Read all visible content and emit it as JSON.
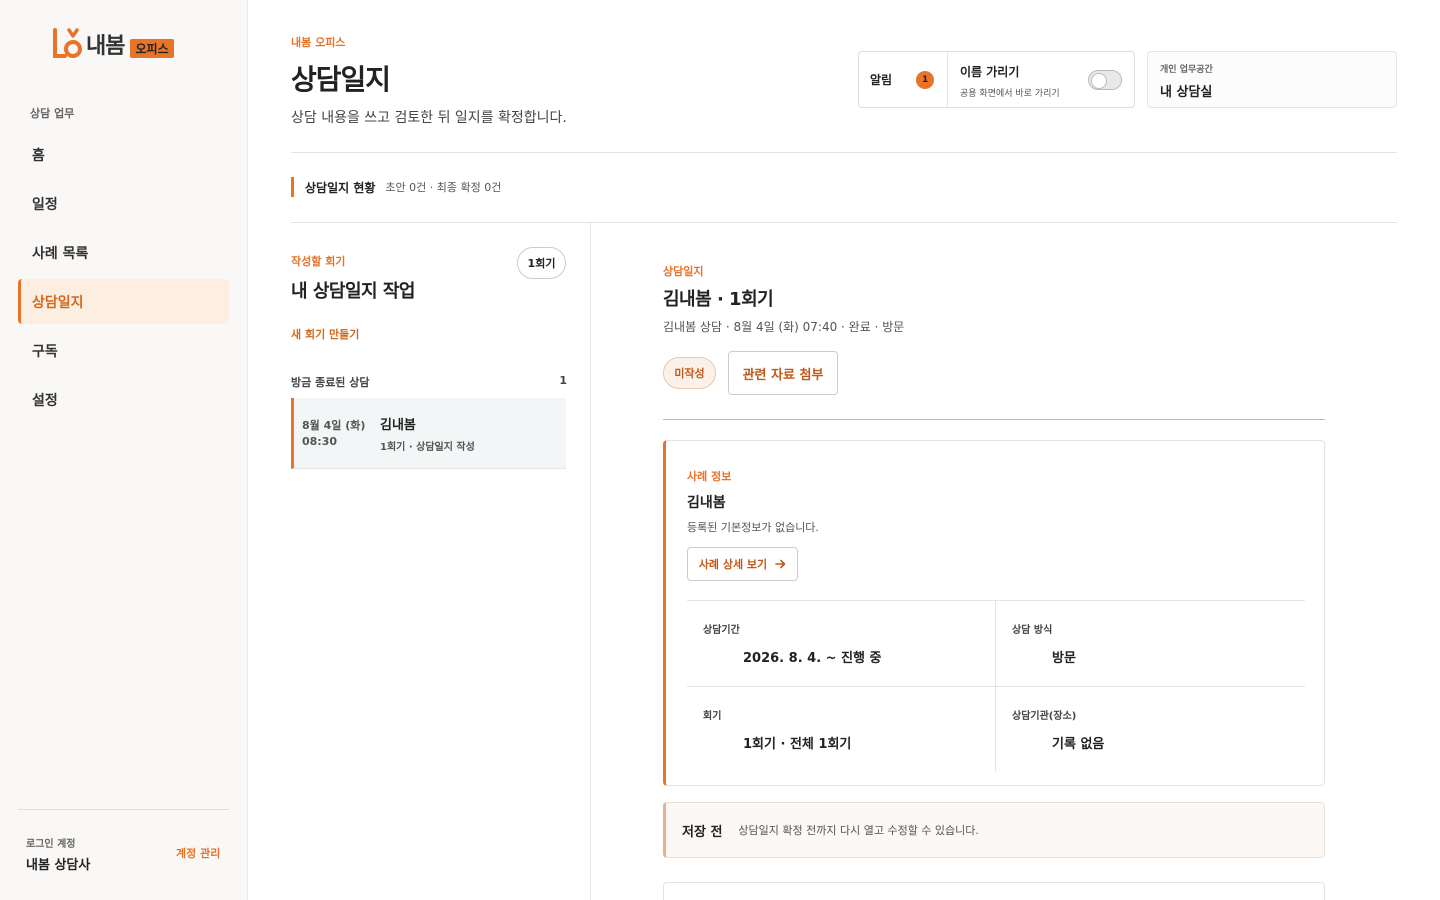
{
  "sidebar": {
    "logo_text": "내봄",
    "logo_badge": "오피스",
    "section_label": "상담 업무",
    "items": [
      {
        "label": "홈"
      },
      {
        "label": "일정"
      },
      {
        "label": "사례 목록"
      },
      {
        "label": "상담일지"
      },
      {
        "label": "구독"
      },
      {
        "label": "설정"
      }
    ],
    "account_label": "로그인 계정",
    "account_name": "내봄 상담사",
    "account_manage": "계정 관리"
  },
  "header": {
    "eyebrow": "내봄 오피스",
    "title": "상담일지",
    "subtitle": "상담 내용을 쓰고 검토한 뒤 일지를 확정합니다.",
    "notification_label": "알림",
    "notification_count": "1",
    "hide_name_title": "이름 가리기",
    "hide_name_sub": "공용 화면에서 바로 가리기",
    "workspace_label": "개인 업무공간",
    "workspace_value": "내 상담실"
  },
  "status": {
    "title": "상담일지 현황",
    "text": "초안 0건 · 최종 확정 0건"
  },
  "left_panel": {
    "eyebrow": "작성할 회기",
    "title": "내 상담일지 작업",
    "session_pill": "1회기",
    "new_session": "새 회기 만들기",
    "section_label": "방금 종료된 상담",
    "section_count": "1",
    "item": {
      "date": "8월 4일 (화)",
      "time": "08:30",
      "name": "김내봄",
      "meta": "1회기 · 상담일지 작성"
    }
  },
  "right_panel": {
    "eyebrow": "상담일지",
    "title": "김내봄 · 1회기",
    "meta": "김내봄 상담 · 8월 4일 (화) 07:40 · 완료 · 방문",
    "draft_badge": "미작성",
    "attach_button": "관련 자료 첨부",
    "case": {
      "eyebrow": "사례 정보",
      "name": "김내봄",
      "desc": "등록된 기본정보가 없습니다.",
      "detail_button": "사례 상세 보기",
      "cells": [
        {
          "label": "상담기간",
          "value": "2026. 8. 4. ~ 진행 중"
        },
        {
          "label": "상담 방식",
          "value": "방문"
        },
        {
          "label": "회기",
          "value": "1회기 · 전체 1회기"
        },
        {
          "label": "상담기관(장소)",
          "value": "기록 없음"
        }
      ]
    },
    "save": {
      "title": "저장 전",
      "text": "상담일지 확정 전까지 다시 열고 수정할 수 있습니다."
    }
  },
  "colors": {
    "accent": "#e8742a",
    "accent_dark": "#c05a1a",
    "active_bg": "#fdeee2"
  }
}
